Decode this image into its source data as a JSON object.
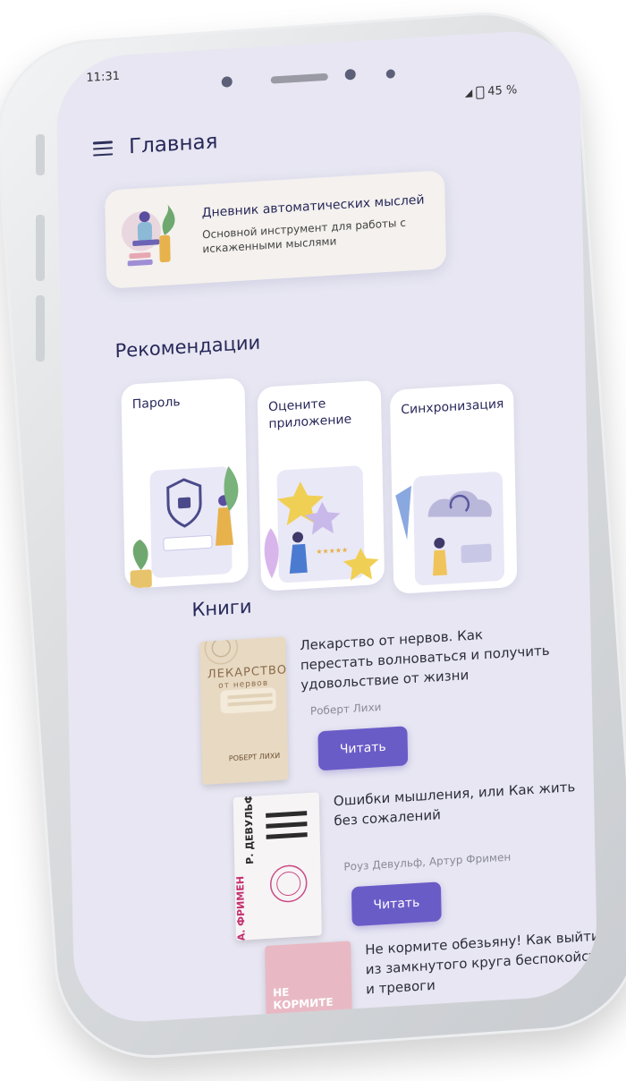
{
  "status": {
    "time": "11:31",
    "battery": "45 %"
  },
  "header": {
    "title": "Главная"
  },
  "diary": {
    "title": "Дневник автоматических мыслей",
    "subtitle": "Основной инструмент для работы с искаженными мыслями"
  },
  "recommendations": {
    "heading": "Рекомендации",
    "items": [
      {
        "label": "Пароль"
      },
      {
        "label": "Оцените приложение"
      },
      {
        "label": "Синхронизация"
      }
    ]
  },
  "books": {
    "heading": "Книги",
    "items": [
      {
        "title": "Лекарство от нервов. Как перестать волноваться и получить удовольствие от жизни",
        "author": "Роберт Лихи",
        "button": "Читать",
        "cover_title": "ЛЕКАРСТВО",
        "cover_sub": "от нервов",
        "cover_author": "РОБЕРТ ЛИХИ"
      },
      {
        "title": "Ошибки мышления, или Как жить без сожалений",
        "author": "Роуз Девульф, Артур Фримен",
        "button": "Читать",
        "cover_author1": "Р. ДЕВУЛЬФ",
        "cover_author2": "А. ФРИМЕН"
      },
      {
        "title": "Не кормите обезьяну! Как выйти из замкнутого круга беспокойства и тревоги",
        "cover_title": "НЕ КОРМИТЕ"
      }
    ]
  },
  "colors": {
    "accent": "#6a5cc7",
    "screen_bg": "#e7e6f2",
    "text": "#27285a"
  }
}
